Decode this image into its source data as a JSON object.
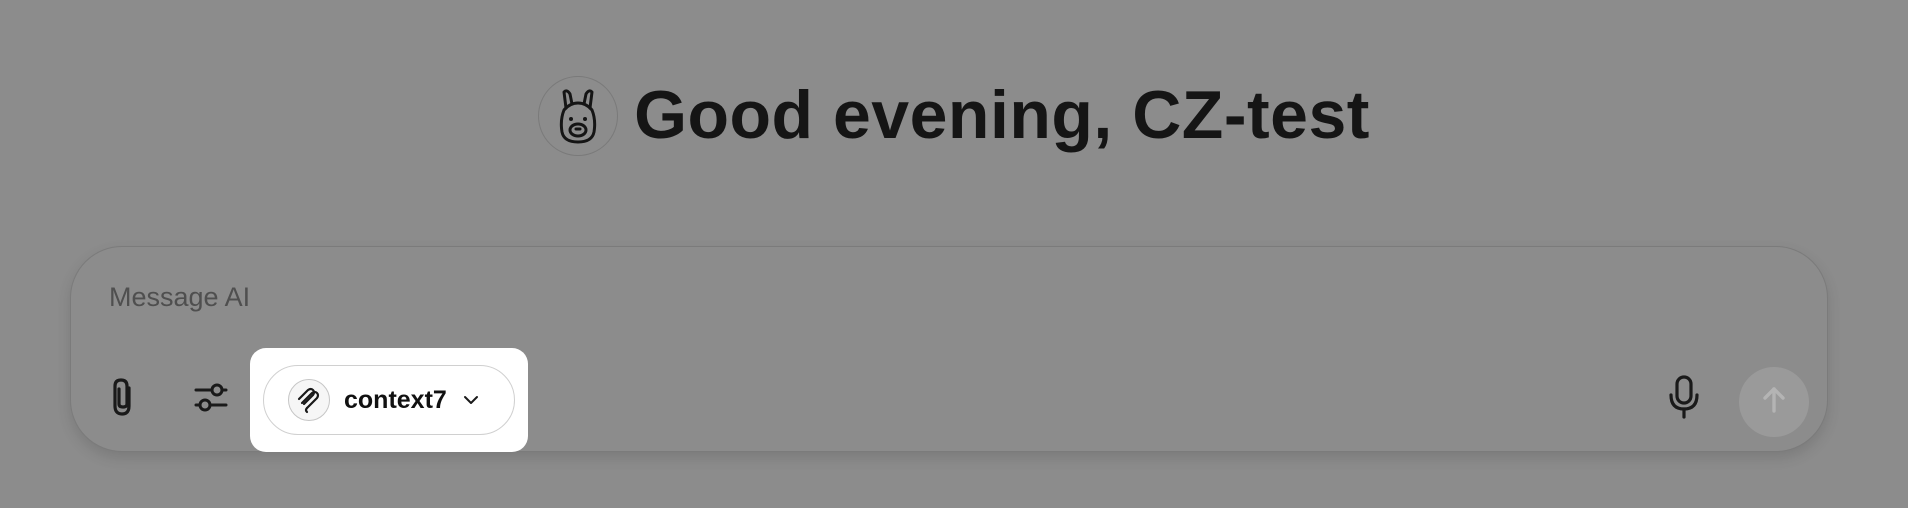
{
  "greeting": {
    "text": "Good evening, CZ-test",
    "avatar_icon": "llama-icon"
  },
  "composer": {
    "placeholder": "Message AI",
    "attach_icon": "paperclip-icon",
    "settings_icon": "sliders-icon",
    "mic_icon": "microphone-icon",
    "send_icon": "arrow-up-icon"
  },
  "tool": {
    "name": "context7",
    "logo_icon": "context7-logo-icon",
    "dropdown_icon": "chevron-down-icon"
  },
  "colors": {
    "overlay": "#8c8c8c",
    "highlight": "#ffffff",
    "text": "#151515",
    "placeholder": "#4f4f4f",
    "send_disabled": "#9a9a9a"
  }
}
